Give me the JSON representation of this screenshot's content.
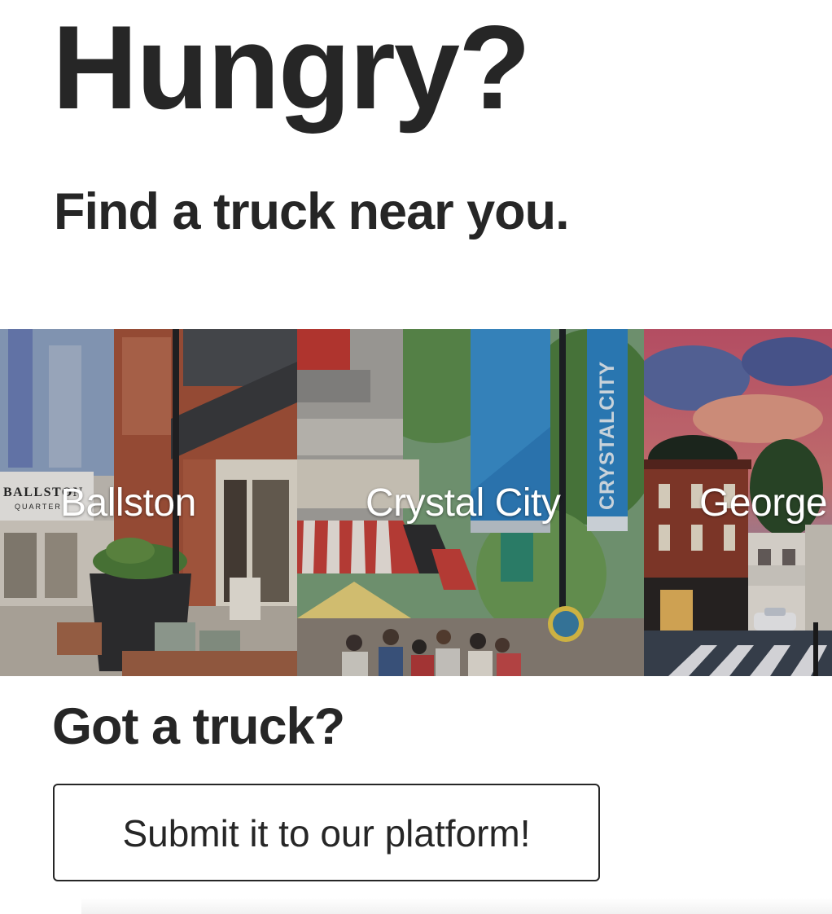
{
  "hero": {
    "title": "Hungry?",
    "subtitle": "Find a truck near you."
  },
  "locations": [
    {
      "label": "Ballston",
      "sign_text": "BALLSTON",
      "sign_sub": "QUARTER"
    },
    {
      "label": "Crystal City",
      "banner_text": "CRYSTALCITY"
    },
    {
      "label": "George"
    }
  ],
  "owners": {
    "title": "Got a truck?",
    "submit_label": "Submit it to our platform!"
  },
  "colors": {
    "text": "#262626",
    "background": "#ffffff",
    "label_text": "#ffffff"
  }
}
